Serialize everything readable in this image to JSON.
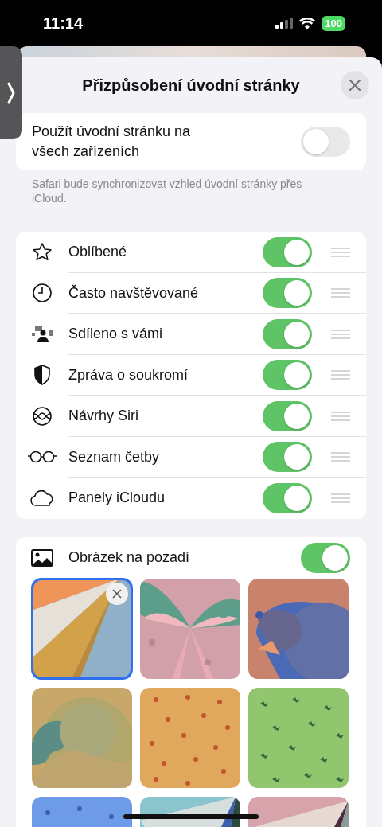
{
  "status_bar": {
    "time": "11:14",
    "battery": "100"
  },
  "sheet": {
    "title": "Přizpůsobení úvodní stránky"
  },
  "sync": {
    "label": "Použít úvodní stránku na všech zařízeních",
    "on": false,
    "footer": "Safari bude synchronizovat vzhled úvodní stránky přes iCloud."
  },
  "sections": [
    {
      "label": "Oblíbené",
      "on": true
    },
    {
      "label": "Často navštěvované",
      "on": true
    },
    {
      "label": "Sdíleno s vámi",
      "on": true
    },
    {
      "label": "Zpráva o soukromí",
      "on": true
    },
    {
      "label": "Návrhy Siri",
      "on": true
    },
    {
      "label": "Seznam četby",
      "on": true
    },
    {
      "label": "Panely iCloudu",
      "on": true
    }
  ],
  "background": {
    "label": "Obrázek na pozadí",
    "on": true,
    "wallpapers": [
      {
        "kind": "picture",
        "selected": true
      },
      {
        "kind": "picture",
        "selected": false
      },
      {
        "kind": "picture",
        "selected": false
      },
      {
        "kind": "picture",
        "selected": false
      },
      {
        "kind": "picture",
        "selected": false
      },
      {
        "kind": "picture",
        "selected": false
      },
      {
        "kind": "picture",
        "selected": false
      },
      {
        "kind": "picture",
        "selected": false
      },
      {
        "kind": "picture",
        "selected": false
      }
    ]
  }
}
